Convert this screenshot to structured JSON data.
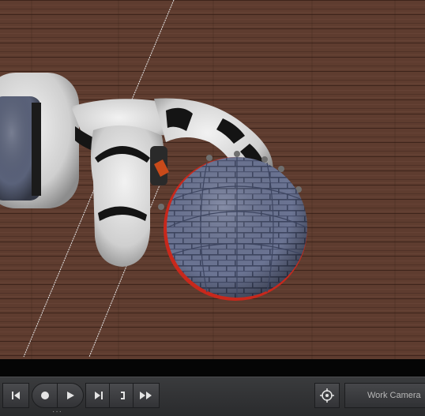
{
  "viewport": {
    "scene_objects": [
      "wooden-floor",
      "robot-arm",
      "robot-gripper",
      "textured-sphere",
      "camera-frustum-lines"
    ],
    "floor_color": "#5b3a2e",
    "sphere_color": "#6a7391",
    "highlight_color": "#c8281c"
  },
  "playback": {
    "buttons": [
      "step-back",
      "record",
      "play",
      "step-forward",
      "frame-marker",
      "fast-forward"
    ],
    "active_button": "record"
  },
  "camera": {
    "target_icon": "crosshair-target-icon",
    "label": "Work Camera"
  },
  "colors": {
    "toolbar_bg": "#333437",
    "accent": "#c8281c"
  }
}
